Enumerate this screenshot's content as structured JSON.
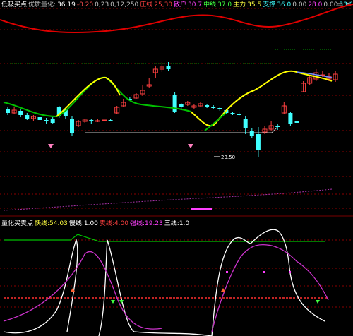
{
  "top_header": {
    "title": "低吸买点",
    "items": [
      {
        "text": "优质量化:",
        "color": "#c0c0c0"
      },
      {
        "text": "36.19",
        "color": "#ffffff"
      },
      {
        "text": "-0.20",
        "color": "#ff5050"
      },
      {
        "text": "0,23",
        "color": "#c0c0c0"
      },
      {
        "text": "0,12,250",
        "color": "#c0c0c0"
      },
      {
        "text": "庄线",
        "color": "#ff4040"
      },
      {
        "text": "25,30",
        "color": "#ff4040"
      },
      {
        "text": "散户",
        "color": "#ff40ff"
      },
      {
        "text": "30.7",
        "color": "#ff40ff"
      },
      {
        "text": "中线",
        "color": "#40ff40"
      },
      {
        "text": "37.0",
        "color": "#40ff40"
      },
      {
        "text": "主力",
        "color": "#ffff40"
      },
      {
        "text": "35.5",
        "color": "#ffff40"
      },
      {
        "text": "支撑",
        "color": "#40ffff"
      },
      {
        "text": "36.0",
        "color": "#40ffff"
      },
      {
        "text": "0.00",
        "color": "#c0c0c0"
      },
      {
        "text": "28.0",
        "color": "#ff40ff"
      },
      {
        "text": "0.00",
        "color": "#c0c0c0"
      },
      {
        "text": "33.0",
        "color": "#40ffff"
      }
    ]
  },
  "price_annotation": "23.50",
  "bottom_header": {
    "title": "量化买卖点",
    "items": [
      {
        "label": "快线:",
        "value": "54.03",
        "color": "#ffff40"
      },
      {
        "label": "慢线:",
        "value": "1.00",
        "color": "#ffffff"
      },
      {
        "label": "卖线:",
        "value": "4.00",
        "color": "#ff4040"
      },
      {
        "label": "强线:",
        "value": "19.23",
        "color": "#ff40ff"
      },
      {
        "label": "三线:",
        "value": "1.0",
        "color": "#ffffff"
      }
    ]
  },
  "window_controls": {
    "min": "▭",
    "close": "×"
  },
  "colors": {
    "up": "#ff4040",
    "down": "#40ffff",
    "grid": "#8b0000",
    "ribbon": "#e00000",
    "ma_yellow": "#ffff00",
    "ma_green": "#00c000",
    "kdj_white": "#ffffff",
    "kdj_purple": "#cc33cc",
    "band_green": "#00c000",
    "baseline": "#ff3030",
    "buy_marker": "#ff80c0"
  },
  "chart_data": {
    "type": "candlestick",
    "candles": [
      {
        "o": 154,
        "c": 160,
        "h": 151,
        "l": 163
      },
      {
        "o": 160,
        "c": 156,
        "h": 152,
        "l": 161
      },
      {
        "o": 157,
        "c": 163,
        "h": 155,
        "l": 166
      },
      {
        "o": 163,
        "c": 168,
        "h": 160,
        "l": 170
      },
      {
        "o": 168,
        "c": 165,
        "h": 163,
        "l": 171
      },
      {
        "o": 166,
        "c": 170,
        "h": 164,
        "l": 173
      },
      {
        "o": 170,
        "c": 172,
        "h": 167,
        "l": 175
      },
      {
        "o": 168,
        "c": 174,
        "h": 166,
        "l": 176
      },
      {
        "o": 152,
        "c": 164,
        "h": 150,
        "l": 167
      },
      {
        "o": 155,
        "c": 165,
        "h": 153,
        "l": 168
      },
      {
        "o": 168,
        "c": 189,
        "h": 165,
        "l": 192
      },
      {
        "o": 178,
        "c": 172,
        "h": 170,
        "l": 180
      },
      {
        "o": 172,
        "c": 170,
        "h": 168,
        "l": 174
      },
      {
        "o": 170,
        "c": 172,
        "h": 168,
        "l": 175
      },
      {
        "o": 172,
        "c": 171,
        "h": 169,
        "l": 173
      },
      {
        "o": 171,
        "c": 170,
        "h": 168,
        "l": 173
      },
      {
        "o": 170,
        "c": 170,
        "h": 168,
        "l": 172
      },
      {
        "o": 160,
        "c": 152,
        "h": 150,
        "l": 162
      },
      {
        "o": 150,
        "c": 145,
        "h": 140,
        "l": 152
      },
      {
        "o": 140,
        "c": 141,
        "h": 138,
        "l": 143
      },
      {
        "o": 139,
        "c": 134,
        "h": 132,
        "l": 140
      },
      {
        "o": 133,
        "c": 128,
        "h": 120,
        "l": 136
      },
      {
        "o": 122,
        "c": 120,
        "h": 110,
        "l": 124
      },
      {
        "o": 103,
        "c": 98,
        "h": 94,
        "l": 110
      },
      {
        "o": 98,
        "c": 95,
        "h": 88,
        "l": 102
      },
      {
        "o": 93,
        "c": 98,
        "h": 88,
        "l": 100
      },
      {
        "o": 135,
        "c": 158,
        "h": 130,
        "l": 160
      },
      {
        "o": 148,
        "c": 152,
        "h": 146,
        "l": 154
      },
      {
        "o": 148,
        "c": 145,
        "h": 143,
        "l": 150
      },
      {
        "o": 152,
        "c": 150,
        "h": 148,
        "l": 154
      },
      {
        "o": 150,
        "c": 147,
        "h": 145,
        "l": 152
      },
      {
        "o": 149,
        "c": 151,
        "h": 147,
        "l": 153
      },
      {
        "o": 151,
        "c": 153,
        "h": 149,
        "l": 155
      },
      {
        "o": 153,
        "c": 155,
        "h": 151,
        "l": 157
      },
      {
        "o": 156,
        "c": 160,
        "h": 154,
        "l": 162
      },
      {
        "o": 160,
        "c": 162,
        "h": 158,
        "l": 163
      },
      {
        "o": 161,
        "c": 163,
        "h": 159,
        "l": 164
      },
      {
        "o": 168,
        "c": 182,
        "h": 165,
        "l": 190
      },
      {
        "o": 185,
        "c": 193,
        "h": 182,
        "l": 196
      },
      {
        "o": 190,
        "c": 212,
        "h": 180,
        "l": 223
      },
      {
        "o": 187,
        "c": 183,
        "h": 178,
        "l": 190
      },
      {
        "o": 183,
        "c": 178,
        "h": 172,
        "l": 186
      },
      {
        "o": 178,
        "c": 180,
        "h": 176,
        "l": 184
      },
      {
        "o": 160,
        "c": 150,
        "h": 145,
        "l": 162
      },
      {
        "o": 160,
        "c": 175,
        "h": 158,
        "l": 178
      },
      {
        "o": 172,
        "c": 174,
        "h": 169,
        "l": 176
      },
      {
        "o": 130,
        "c": 118,
        "h": 115,
        "l": 130
      },
      {
        "o": 118,
        "c": 110,
        "h": 106,
        "l": 120
      },
      {
        "o": 112,
        "c": 103,
        "h": 98,
        "l": 115
      },
      {
        "o": 107,
        "c": 106,
        "h": 101,
        "l": 109
      },
      {
        "o": 112,
        "c": 108,
        "h": 103,
        "l": 115
      },
      {
        "o": 113,
        "c": 105,
        "h": 101,
        "l": 116
      }
    ]
  }
}
